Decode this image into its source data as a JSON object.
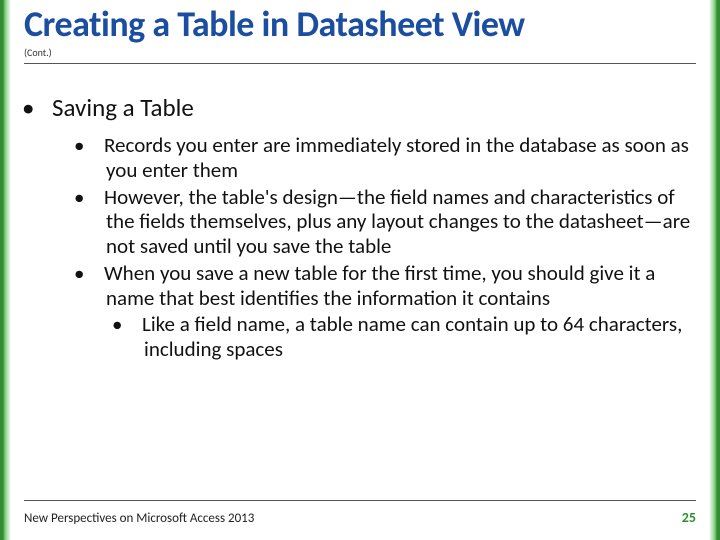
{
  "header": {
    "title": "Creating a Table in Datasheet View",
    "cont": "(Cont.)"
  },
  "bullets": {
    "lvl1": "Saving a Table",
    "lvl2a": "Records you enter are immediately stored in the database as soon as you enter them",
    "lvl2b": "However, the table's design—the field names and characteristics of the fields themselves, plus any layout changes to the datasheet—are not saved until you save the table",
    "lvl2c": "When you save a new table for the first time, you should give it a name that best identifies the information it contains",
    "lvl3a": "Like a field name, a table name can contain up to 64 characters, including spaces"
  },
  "footer": {
    "text": "New Perspectives on Microsoft Access 2013",
    "page": "25"
  }
}
